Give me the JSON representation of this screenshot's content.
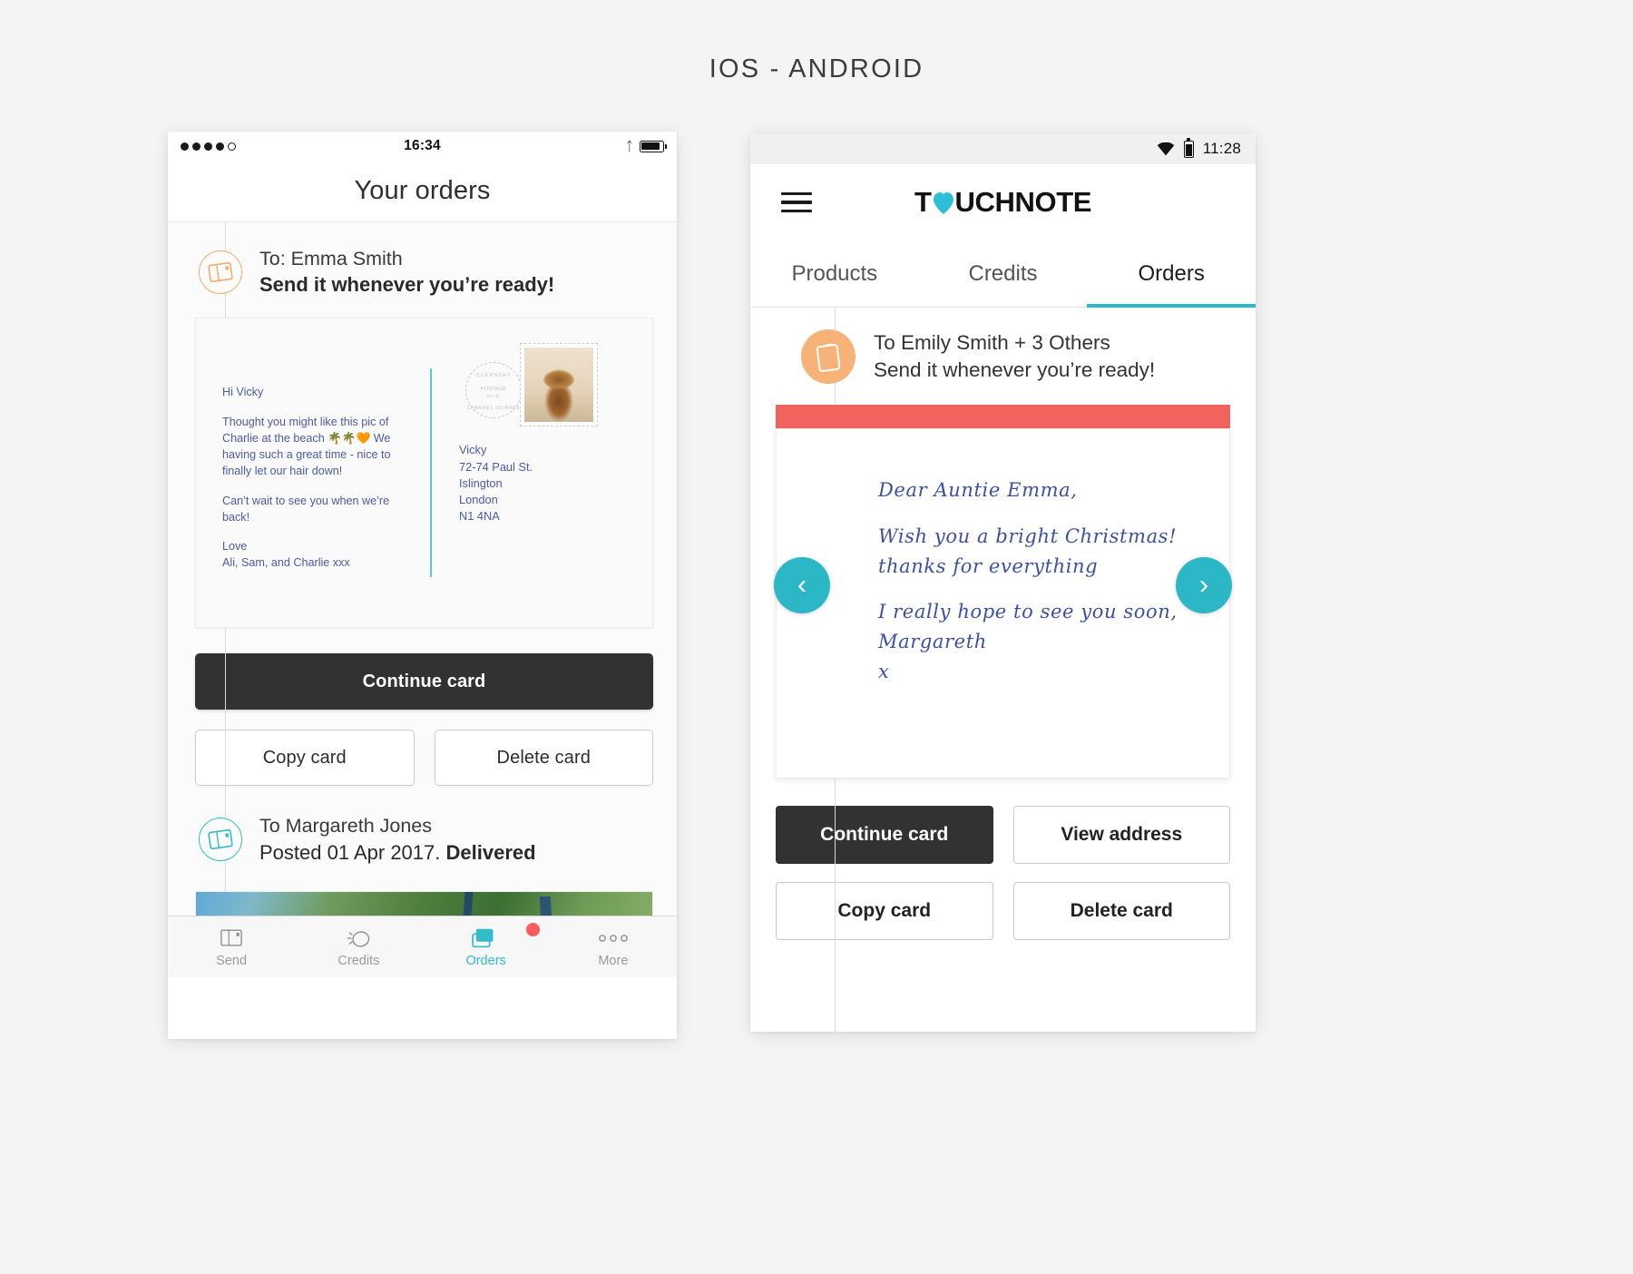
{
  "header": {
    "title": "IOS - ANDROID"
  },
  "ios": {
    "status": {
      "time": "16:34",
      "bluetooth_icon": "bluetooth-icon",
      "battery_icon": "battery-icon"
    },
    "nav_title": "Your orders",
    "orders": [
      {
        "icon": "postcard-icon",
        "recipient": "To: Emma Smith",
        "status": "Send it whenever you’re ready!",
        "postcard": {
          "message": [
            "Hi Vicky",
            "Thought you might like this pic of Charlie at the beach 🌴🌴🧡 We having such a great time - nice to finally let our hair down!",
            "Can’t wait to see you when we’re back!",
            "Love\nAli, Sam, and Charlie xxx"
          ],
          "address": [
            "Vicky",
            "72-74 Paul St.",
            "Islington",
            "London",
            "N1 4NA"
          ],
          "postmark": {
            "line1": "GUERNSEY",
            "line2": "POSTAGE",
            "line3": "PAID",
            "line4": "CHANNEL ISLANDS"
          },
          "stamp_alt": "dog-stamp-image"
        },
        "buttons": {
          "primary": "Continue card",
          "copy": "Copy card",
          "delete": "Delete card"
        }
      },
      {
        "icon": "postcard-icon",
        "recipient": "To Margareth Jones",
        "status_prefix": "Posted 01 Apr 2017. ",
        "status_bold": "Delivered",
        "photo_alt": "child-in-blue-hat-photo"
      }
    ],
    "tabs": [
      {
        "label": "Send",
        "icon": "postcard-outline-icon",
        "active": false,
        "badge": false
      },
      {
        "label": "Credits",
        "icon": "coin-icon",
        "active": false,
        "badge": false
      },
      {
        "label": "Orders",
        "icon": "stacked-cards-icon",
        "active": true,
        "badge": true
      },
      {
        "label": "More",
        "icon": "ellipsis-icon",
        "active": false,
        "badge": false
      }
    ]
  },
  "android": {
    "status": {
      "time": "11:28",
      "wifi_icon": "wifi-icon",
      "battery_icon": "battery-icon"
    },
    "menu_icon": "hamburger-menu-icon",
    "logo": {
      "pre": "T",
      "heart": "heart-icon",
      "post": "UCHNOTE",
      "full": "TOUCHNOTE"
    },
    "tabs": [
      {
        "label": "Products",
        "active": false
      },
      {
        "label": "Credits",
        "active": false
      },
      {
        "label": "Orders",
        "active": true
      }
    ],
    "order": {
      "icon": "card-icon",
      "recipient": "To Emily Smith + 3 Others",
      "status": "Send it whenever you’re ready!",
      "card": {
        "band_color": "#f2635e",
        "handwriting": [
          "Dear Auntie Emma,",
          "Wish you a bright Christmas!",
          "thanks for everything",
          "I really hope to see you soon,",
          "Margareth",
          "x"
        ]
      },
      "nav": {
        "prev_icon": "chevron-left-icon",
        "next_icon": "chevron-right-icon"
      },
      "buttons": {
        "continue": "Continue card",
        "view_address": "View address",
        "copy": "Copy card",
        "delete": "Delete card"
      }
    }
  },
  "colors": {
    "accent_teal": "#2bb7c6",
    "accent_orange": "#f7b277",
    "band_red": "#f2635e",
    "dark_button": "#323232",
    "handwriting_blue": "#3d4fa8",
    "postcard_text_blue": "#4c5aa8"
  }
}
